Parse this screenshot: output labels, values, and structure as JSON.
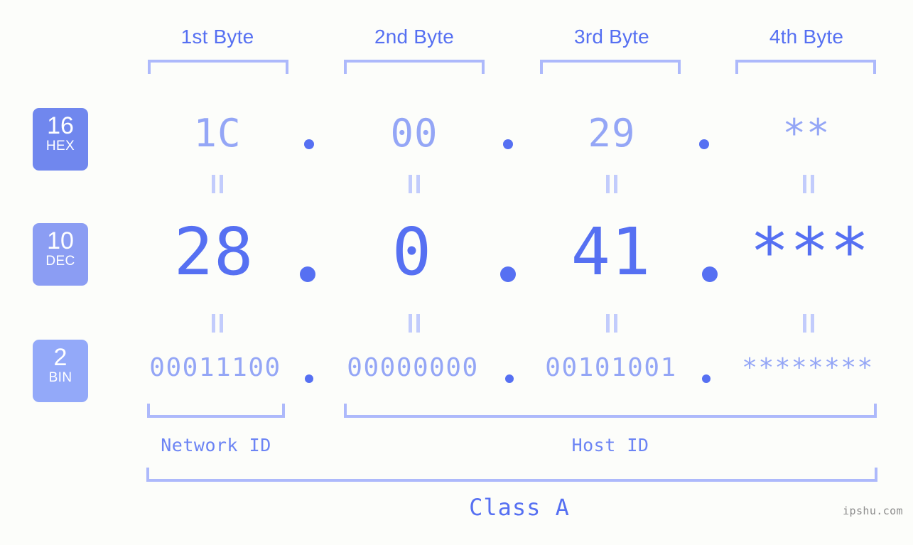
{
  "meta": {
    "background_color": "#fcfdfa",
    "accent_strong": "#5670f2",
    "accent_mid": "#8b9df3",
    "accent_light": "#94a6f6",
    "bracket_color": "#adb9fb",
    "watermark": "ipshu.com"
  },
  "byte_headers": [
    {
      "label": "1st Byte"
    },
    {
      "label": "2nd Byte"
    },
    {
      "label": "3rd Byte"
    },
    {
      "label": "4th Byte"
    }
  ],
  "bases": [
    {
      "num": "16",
      "name": "HEX",
      "color": "#7087ee"
    },
    {
      "num": "10",
      "name": "DEC",
      "color": "#8b9df3"
    },
    {
      "num": "2",
      "name": "BIN",
      "color": "#93a9f9"
    }
  ],
  "rows": {
    "hex": {
      "values": [
        "1C",
        "00",
        "29",
        "**"
      ],
      "separators": [
        ".",
        ".",
        "."
      ]
    },
    "dec": {
      "values": [
        "28",
        "0",
        "41",
        "***"
      ],
      "separators": [
        ".",
        ".",
        "."
      ]
    },
    "bin": {
      "values": [
        "00011100",
        "00000000",
        "00101001",
        "********"
      ],
      "separators": [
        ".",
        ".",
        "."
      ]
    }
  },
  "equals_symbol": "=",
  "id_brackets": [
    {
      "label": "Network ID"
    },
    {
      "label": "Host ID"
    }
  ],
  "class": {
    "label": "Class A"
  }
}
